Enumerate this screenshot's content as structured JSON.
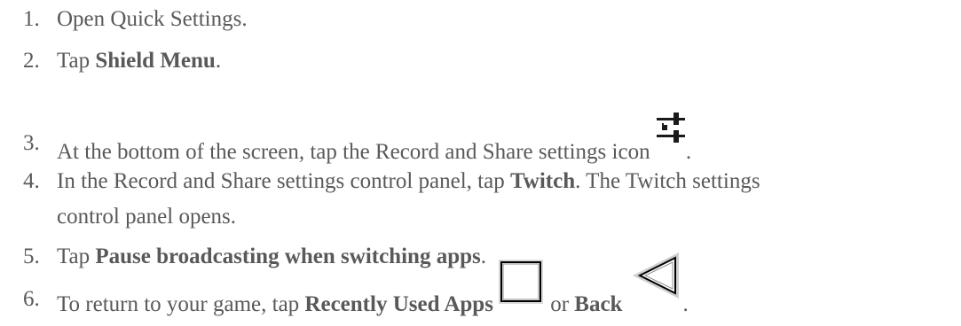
{
  "steps": [
    {
      "num": "1.",
      "parts": [
        "Open Quick Settings."
      ]
    },
    {
      "num": "2.",
      "pre": "Tap ",
      "bold": "Shield Menu",
      "post": "."
    },
    {
      "num": "3.",
      "pre": "At the bottom of the screen, tap the Record and Share settings icon ",
      "post": ".",
      "icon": "sliders-settings-icon"
    },
    {
      "num": "4.",
      "pre": "In the Record and Share settings control panel, tap ",
      "bold": "Twitch",
      "post": ". The Twitch settings",
      "cont": "control panel opens."
    },
    {
      "num": "5.",
      "pre": "Tap ",
      "bold": "Pause broadcasting when switching apps",
      "post": "."
    },
    {
      "num": "6.",
      "pre": "To return to your game, tap ",
      "bold": "Recently Used Apps",
      "mid": " or ",
      "bold2": "Back",
      "post": ".",
      "icon": "recent-apps-square-icon",
      "icon2": "back-triangle-icon"
    }
  ]
}
